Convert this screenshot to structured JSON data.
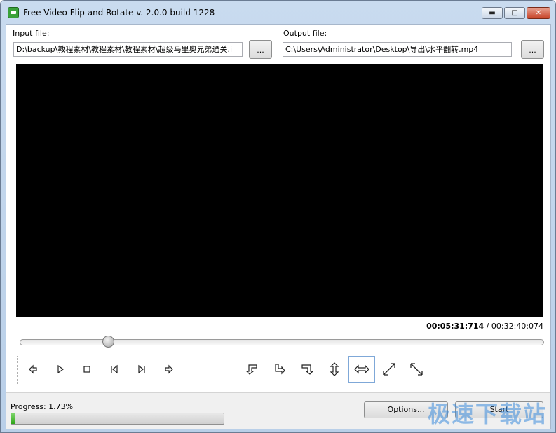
{
  "window": {
    "title": "Free Video Flip and Rotate  v. 2.0.0 build 1228",
    "buttons": {
      "minimize": "▬",
      "maximize": "□",
      "close": "✕"
    }
  },
  "input": {
    "label": "Input file:",
    "value": "D:\\backup\\教程素材\\教程素材\\教程素材\\超级马里奥兄弟通关.i",
    "browse_label": "..."
  },
  "output": {
    "label": "Output file:",
    "value": "C:\\Users\\Administrator\\Desktop\\导出\\水平翻转.mp4",
    "browse_label": "..."
  },
  "playback": {
    "current_time": "00:05:31:714",
    "separator": "/",
    "total_time": "00:32:40:074",
    "position_fraction": 0.169
  },
  "controls": {
    "playback_icons": [
      "arrow-left-icon",
      "play-icon",
      "stop-icon",
      "skip-start-icon",
      "skip-end-icon",
      "arrow-right-icon"
    ],
    "transform_icons": [
      "rotate-ccw-icon",
      "rotate-cw-icon",
      "rotate-180-icon",
      "flip-vertical-icon",
      "flip-horizontal-icon",
      "transpose-icon",
      "transverse-icon"
    ],
    "selected_transform": "flip-horizontal-icon"
  },
  "status": {
    "progress_label": "Progress: 1.73%",
    "progress_value": 1.73,
    "options_label": "Options...",
    "start_label": "Start"
  },
  "watermark": "极速下载站",
  "colors": {
    "progress_fill": "#2ea51a",
    "selected_border": "#7fa8d8",
    "watermark": "#3c8cdc"
  }
}
